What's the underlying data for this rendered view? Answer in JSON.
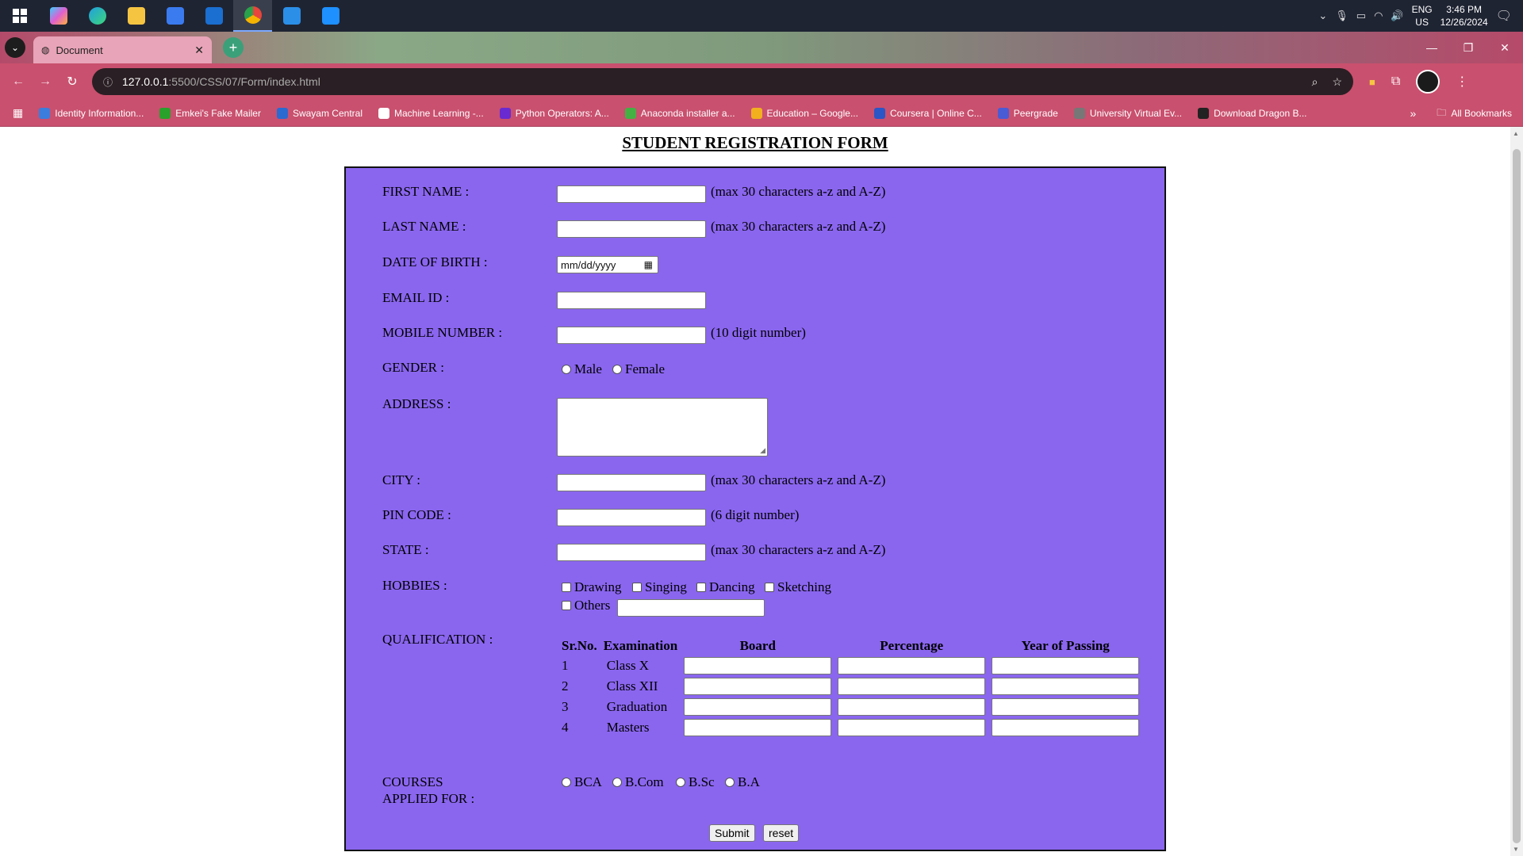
{
  "taskbar": {
    "apps": [
      {
        "name": "windows-start",
        "color": "#ffffff"
      },
      {
        "name": "copilot",
        "color": "#e05fd0"
      },
      {
        "name": "edge",
        "color": "#1fa0e0"
      },
      {
        "name": "file-explorer",
        "color": "#f5c542"
      },
      {
        "name": "microsoft-store",
        "color": "#3a7bf0"
      },
      {
        "name": "outlook",
        "color": "#1a6fd0"
      },
      {
        "name": "chrome",
        "color": "#e8453c"
      },
      {
        "name": "vscode",
        "color": "#2b8fe8"
      },
      {
        "name": "paint",
        "color": "#1e90ff"
      }
    ],
    "lang_top": "ENG",
    "lang_bottom": "US",
    "time": "3:46 PM",
    "date": "12/26/2024"
  },
  "browser": {
    "tab_title": "Document",
    "url_host": "127.0.0.1",
    "url_path": ":5500/CSS/07/Form/index.html",
    "bookmarks": [
      {
        "label": "Identity Information...",
        "color": "#3b7ddd"
      },
      {
        "label": "Emkei's Fake Mailer",
        "color": "#2aa12a"
      },
      {
        "label": "Swayam Central",
        "color": "#2a6ad1"
      },
      {
        "label": "Machine Learning -...",
        "color": "#ffffff"
      },
      {
        "label": "Python Operators: A...",
        "color": "#6a2ad1"
      },
      {
        "label": "Anaconda installer a...",
        "color": "#44b044"
      },
      {
        "label": "Education – Google...",
        "color": "#f2b01e"
      },
      {
        "label": "Coursera | Online C...",
        "color": "#2a56c6"
      },
      {
        "label": "Peergrade",
        "color": "#4a5bd6"
      },
      {
        "label": "University Virtual Ev...",
        "color": "#777777"
      },
      {
        "label": "Download Dragon B...",
        "color": "#222222"
      }
    ],
    "all_bookmarks": "All Bookmarks"
  },
  "form": {
    "heading": "STUDENT REGISTRATION FORM",
    "background": "#8a66ef",
    "first_name_label": "FIRST NAME :",
    "first_name_hint": "(max 30 characters a-z and A-Z)",
    "last_name_label": "LAST NAME :",
    "last_name_hint": "(max 30 characters a-z and A-Z)",
    "dob_label": "DATE OF BIRTH :",
    "dob_placeholder": "mm/dd/yyyy",
    "email_label": "EMAIL ID :",
    "mobile_label": "MOBILE NUMBER :",
    "mobile_hint": "(10 digit number)",
    "gender_label": "GENDER :",
    "gender_options": [
      "Male",
      "Female"
    ],
    "address_label": "ADDRESS :",
    "city_label": "CITY :",
    "city_hint": "(max 30 characters a-z and A-Z)",
    "pin_label": "PIN CODE :",
    "pin_hint": "(6 digit number)",
    "state_label": "STATE :",
    "state_hint": "(max 30 characters a-z and A-Z)",
    "hobbies_label": "HOBBIES :",
    "hobbies": [
      "Drawing",
      "Singing",
      "Dancing",
      "Sketching"
    ],
    "hobby_others": "Others",
    "qualification_label": "QUALIFICATION :",
    "qual_headers": [
      "Sr.No.",
      "Examination",
      "Board",
      "Percentage",
      "Year of Passing"
    ],
    "qual_rows": [
      {
        "sr": "1",
        "exam": "Class X"
      },
      {
        "sr": "2",
        "exam": "Class XII"
      },
      {
        "sr": "3",
        "exam": "Graduation"
      },
      {
        "sr": "4",
        "exam": "Masters"
      }
    ],
    "courses_label_1": "COURSES",
    "courses_label_2": "APPLIED FOR :",
    "courses": [
      "BCA",
      "B.Com",
      "B.Sc",
      "B.A"
    ],
    "submit": "Submit",
    "reset": "reset"
  }
}
